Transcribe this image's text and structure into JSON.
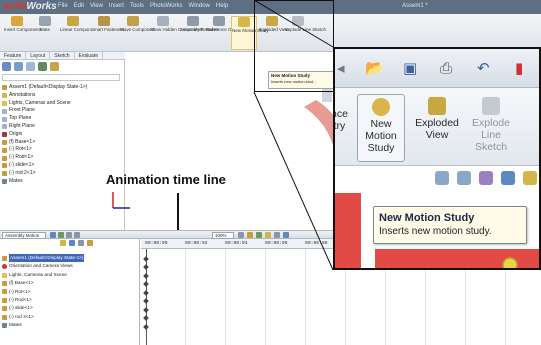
{
  "app": {
    "logo_prefix": "solid",
    "logo_suffix": "Works",
    "menus": [
      "File",
      "Edit",
      "View",
      "Insert",
      "Tools",
      "PhotoWorks",
      "Window",
      "Help"
    ],
    "document_title": "Assem1 *"
  },
  "ribbon": {
    "buttons": [
      "Insert Components",
      "Mate",
      "Linear Compon...",
      "Smart Fasteners",
      "Move Component",
      "Show Hidden Components",
      "Assembly Features",
      "Reference Geometry",
      "New Motion Study",
      "Exploded View",
      "Explode Line Sketch"
    ]
  },
  "feature_tabs": [
    "Feature",
    "Layout",
    "Sketch",
    "Evaluate"
  ],
  "feature_tree": {
    "items": [
      "Assem1 (Default<Display State-1>)",
      "Annotations",
      "Lights, Cameras and Scene",
      "Front Plane",
      "Top Plane",
      "Right Plane",
      "Origin",
      "(f) Base<1>",
      "(-) Rot<1>",
      "(-) Rod<1>",
      "(-) slide<1>",
      "(-) rod 2<1>",
      "Mates"
    ]
  },
  "annotation": {
    "label": "Animation time line"
  },
  "small_tooltip": {
    "title": "New Motion Study",
    "desc": "Inserts new motion stud..."
  },
  "motion_manager": {
    "study_type": "Assembly Motion",
    "zoom_value": "100%",
    "tree_items": [
      "Assem1 (Default<Display State-1>)",
      "Orientation and Camera Views",
      "Lights, Cameras and Scene",
      "(f) Base<1>",
      "(-) Rot<1>",
      "(-) Rod<1>",
      "(-) slide<1>",
      "(-) rod 2<1>",
      "Mates"
    ],
    "time_ticks": [
      "00:00:00",
      "00:00:02",
      "00:00:04",
      "00:00:06",
      "00:00:08"
    ]
  },
  "zoom_view": {
    "ribbon_buttons": {
      "partial_left": "nce\ntry",
      "new_motion_study": [
        "New",
        "Motion",
        "Study"
      ],
      "exploded_view": [
        "Exploded",
        "View"
      ],
      "explode_line_sketch": [
        "Explode",
        "Line",
        "Sketch"
      ]
    },
    "tooltip_title": "New Motion Study",
    "tooltip_desc": "Inserts new motion study."
  },
  "colors": {
    "titlebar": "#5e6e83",
    "part_red": "#e24a45",
    "part_pink": "#e89a94",
    "selection_blue": "#3f67b9"
  }
}
